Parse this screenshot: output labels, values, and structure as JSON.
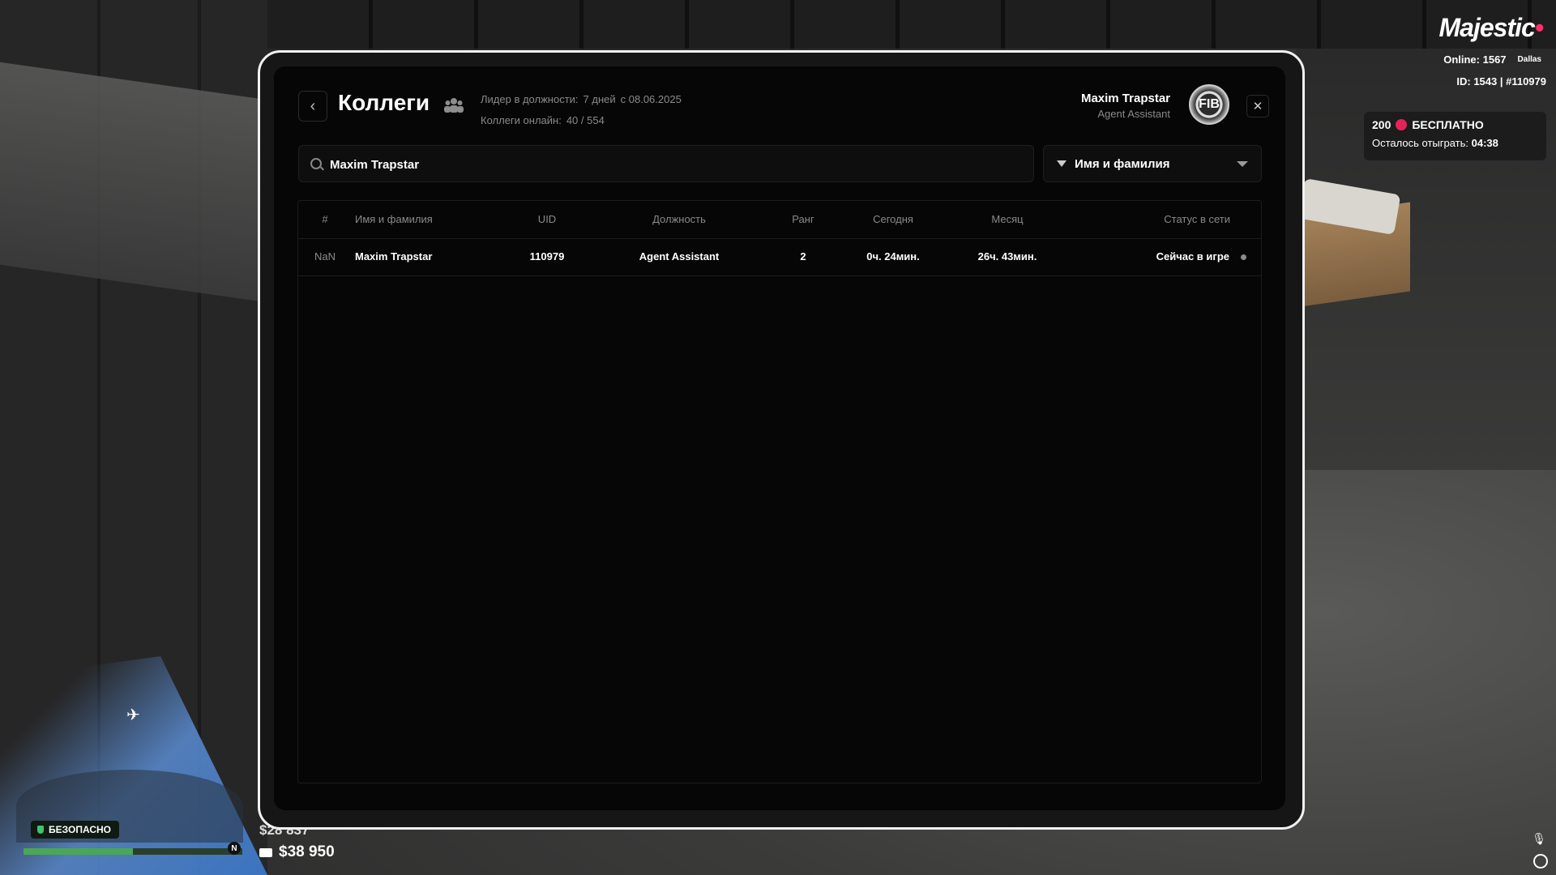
{
  "hud": {
    "brand": "Majestic",
    "online_label": "Online:",
    "online_count": "1567",
    "server": "Dallas",
    "player_id": "ID: 1543 | #110979",
    "promo_amount": "200",
    "promo_label": "БЕСПЛАТНО",
    "promo_remaining_label": "Осталось отыграть:",
    "promo_remaining_time": "04:38",
    "zone_status": "БЕЗОПАСНО",
    "compass": "N",
    "cash": "$28 837",
    "bank": "$38 950"
  },
  "header": {
    "title": "Коллеги",
    "leader_label": "Лидер в должности:",
    "leader_days": "7 дней",
    "leader_since": "с 08.06.2025",
    "online_label": "Коллеги онлайн:",
    "online_value": "40 / 554",
    "user_name": "Maxim Trapstar",
    "user_rank": "Agent Assistant",
    "emblem": "FIB"
  },
  "search": {
    "value": "Maxim Trapstar"
  },
  "filter": {
    "selected": "Имя и фамилия"
  },
  "table": {
    "columns": [
      "#",
      "Имя и фамилия",
      "UID",
      "Должность",
      "Ранг",
      "Сегодня",
      "Месяц",
      "Статус в сети"
    ],
    "rows": [
      {
        "num": "NaN",
        "name": "Maxim Trapstar",
        "uid": "110979",
        "position": "Agent Assistant",
        "rank": "2",
        "today": "0ч. 24мин.",
        "month": "26ч. 43мин.",
        "status": "Сейчас в игре"
      }
    ]
  },
  "icons": {
    "back": "chevron-left-icon",
    "team": "people-icon",
    "close": "close-icon",
    "search": "search-icon",
    "filter": "filter-icon",
    "dropdown": "chevron-down-icon"
  },
  "colors": {
    "accent": "#e2245a",
    "safe": "#3ec46d",
    "health": "#4aa757"
  }
}
